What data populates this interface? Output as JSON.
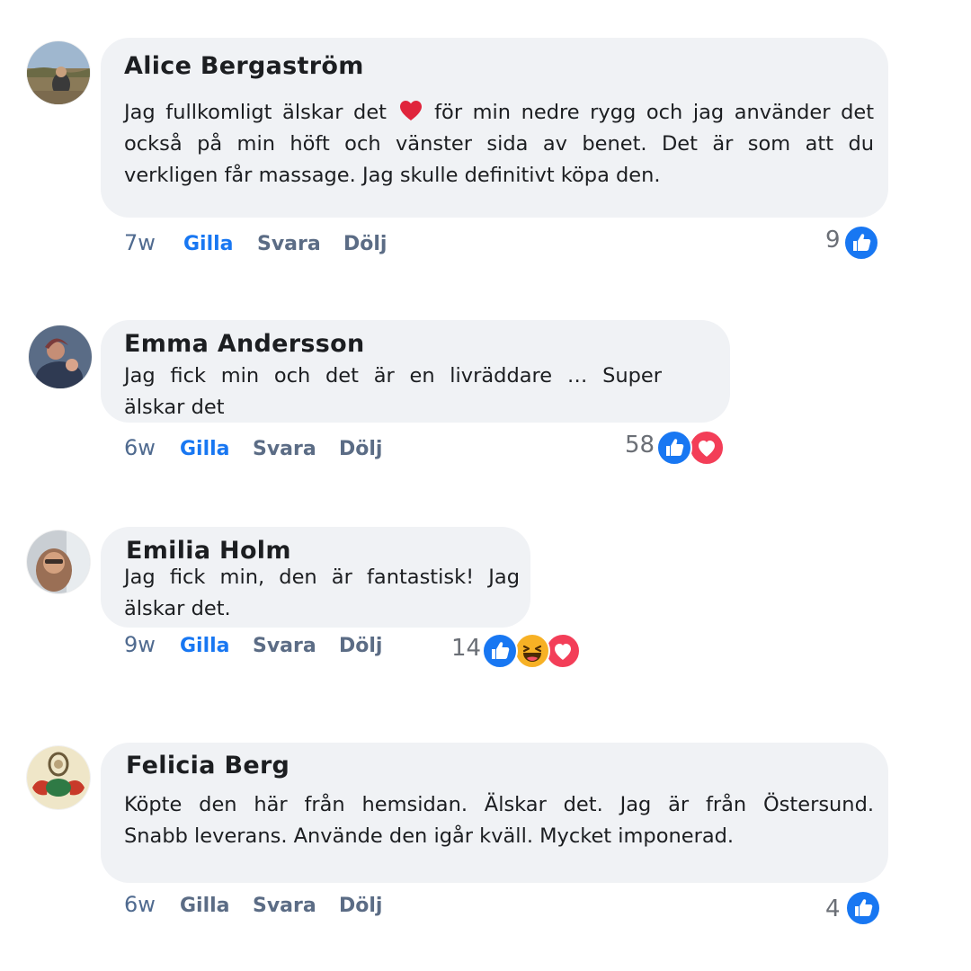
{
  "comments": [
    {
      "author": "Alice Bergaström",
      "text_lines": [
        "Jag fullkomligt älskar det",
        "för min nedre rygg och jag använder det",
        "också på min höft och vänster sida av benet. Det är som att du",
        "verkligen får massage. Jag skulle definitivt köpa den."
      ],
      "inline_emoji": "red-heart-icon",
      "time": "7w",
      "actions": {
        "like": "Gilla",
        "reply": "Svara",
        "hide": "Dölj"
      },
      "reaction_count": "9",
      "reactions": [
        "like-reaction-icon"
      ]
    },
    {
      "author": "Emma Andersson",
      "text_lines": [
        "Jag fick min och det är en livräddare … Super",
        "älskar det"
      ],
      "time": "6w",
      "actions": {
        "like": "Gilla",
        "reply": "Svara",
        "hide": "Dölj"
      },
      "reaction_count": "58",
      "reactions": [
        "like-reaction-icon",
        "love-reaction-icon"
      ]
    },
    {
      "author": "Emilia Holm",
      "text_lines": [
        "Jag fick min, den är fantastisk! Jag",
        "älskar det."
      ],
      "time": "9w",
      "actions": {
        "like": "Gilla",
        "reply": "Svara",
        "hide": "Dölj"
      },
      "reaction_count": "14",
      "reactions": [
        "like-reaction-icon",
        "haha-reaction-icon",
        "love-reaction-icon"
      ]
    },
    {
      "author": "Felicia Berg",
      "text_lines": [
        "Köpte den här från hemsidan. Älskar det. Jag är från Östersund.",
        "Snabb leverans. Använde den igår kväll. Mycket imponerad."
      ],
      "time": "6w",
      "actions": {
        "like": "Gilla",
        "reply": "Svara",
        "hide": "Dölj"
      },
      "reaction_count": "4",
      "reactions": [
        "like-reaction-icon"
      ]
    }
  ],
  "colors": {
    "bubble": "#f0f2f5",
    "like_blue": "#1877f2",
    "love_red": "#f33e58",
    "haha_yellow": "#f7b125",
    "action_gray": "#5b6c85"
  }
}
